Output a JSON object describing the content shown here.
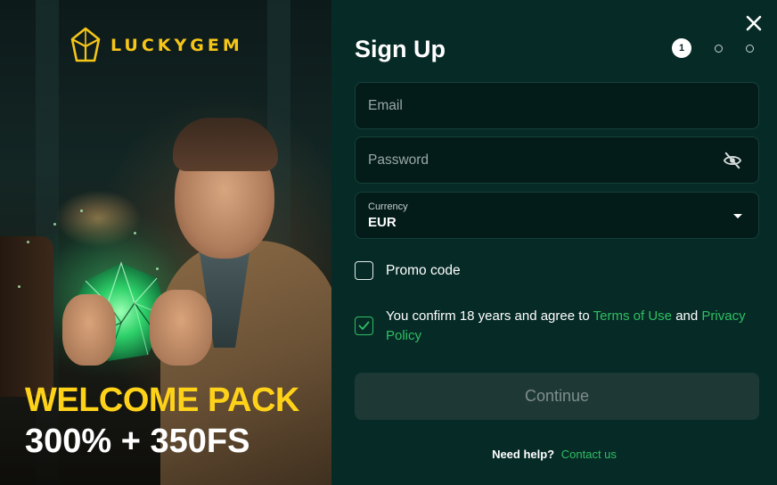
{
  "promo": {
    "logo_text": "LUCKYGEM",
    "headline": "WELCOME PACK",
    "offer": "300% + 350FS"
  },
  "form": {
    "title": "Sign Up",
    "steps": {
      "current": "1",
      "total": 3
    },
    "email_placeholder": "Email",
    "password_placeholder": "Password",
    "currency_label": "Currency",
    "currency_value": "EUR",
    "promo_code_label": "Promo code",
    "promo_code_checked": false,
    "terms_prefix": "You confirm 18 years and agree to",
    "terms_link": "Terms of Use",
    "terms_and": "and",
    "privacy_link": "Privacy Policy",
    "terms_checked": true,
    "continue_label": "Continue",
    "help_question": "Need help?",
    "help_link": "Contact us"
  },
  "colors": {
    "panel_bg": "#062b27",
    "accent_green": "#2fbf62",
    "promo_yellow": "#ffd21a",
    "field_bg": "#031c19",
    "button_disabled_bg": "#1d3835"
  },
  "icons": [
    "gem-logo-icon",
    "close-icon",
    "eye-slash-icon",
    "chevron-down-icon",
    "checkmark-icon"
  ]
}
